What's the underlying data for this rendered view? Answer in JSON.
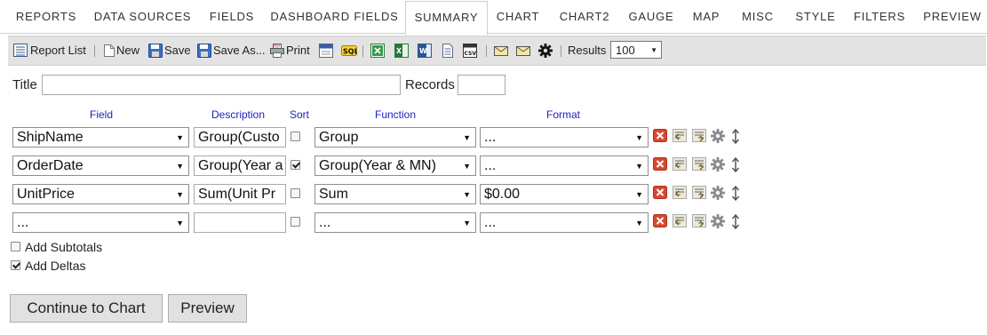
{
  "tabs": [
    "REPORTS",
    "DATA SOURCES",
    "FIELDS",
    "DASHBOARD FIELDS",
    "SUMMARY",
    "CHART",
    "CHART2",
    "GAUGE",
    "MAP",
    "MISC",
    "STYLE",
    "FILTERS",
    "PREVIEW"
  ],
  "active_tab": "SUMMARY",
  "toolbar": {
    "report_list": "Report List",
    "new": "New",
    "save": "Save",
    "save_as": "Save As...",
    "print": "Print",
    "results_label": "Results",
    "results_value": "100",
    "icons": [
      "report-list-icon",
      "new-icon",
      "save-icon",
      "save-as-icon",
      "print-icon",
      "html-export-icon",
      "sql-icon",
      "excel-export-icon",
      "excel-icon",
      "word-icon",
      "document-icon",
      "csv-icon",
      "email-icon",
      "email-icon",
      "gear-icon"
    ]
  },
  "form": {
    "title_label": "Title",
    "title_value": "",
    "records_label": "Records",
    "records_value": ""
  },
  "columns": {
    "field": "Field",
    "description": "Description",
    "sort": "Sort",
    "function": "Function",
    "format": "Format"
  },
  "rows": [
    {
      "field": "ShipName",
      "description": "Group(Custo",
      "sort": false,
      "function": "Group",
      "format": "..."
    },
    {
      "field": "OrderDate",
      "description": "Group(Year a",
      "sort": true,
      "function": "Group(Year & MN)",
      "format": "..."
    },
    {
      "field": "UnitPrice",
      "description": "Sum(Unit Pr",
      "sort": false,
      "function": "Sum",
      "format": "$0.00"
    },
    {
      "field": "...",
      "description": "",
      "sort": false,
      "function": "...",
      "format": "..."
    }
  ],
  "row_icons": [
    "delete-icon",
    "move-up-icon",
    "move-down-icon",
    "gear-icon",
    "reorder-icon"
  ],
  "options": {
    "add_subtotals_label": "Add Subtotals",
    "add_subtotals_checked": false,
    "add_deltas_label": "Add Deltas",
    "add_deltas_checked": true
  },
  "buttons": {
    "continue": "Continue to Chart",
    "preview": "Preview"
  },
  "colors": {
    "column_header": "#2020c8",
    "delete": "#d9482f",
    "toolbar_bg": "#e3e3e3"
  }
}
